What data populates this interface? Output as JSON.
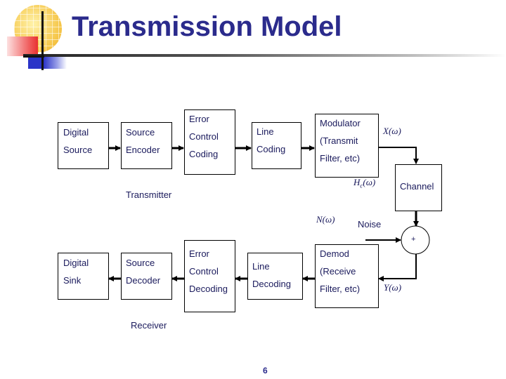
{
  "title": "Transmission Model",
  "transmitter": {
    "label": "Transmitter",
    "blocks": [
      {
        "id": "digital-source",
        "lines": [
          "Digital",
          "Source"
        ]
      },
      {
        "id": "source-encoder",
        "lines": [
          "Source",
          "Encoder"
        ]
      },
      {
        "id": "error-control-coding",
        "lines": [
          "Error",
          "Control",
          "Coding"
        ]
      },
      {
        "id": "line-coding",
        "lines": [
          "Line",
          "Coding"
        ]
      },
      {
        "id": "modulator",
        "lines": [
          "Modulator",
          "(Transmit",
          "Filter, etc)"
        ]
      }
    ]
  },
  "channel": {
    "label": "Channel",
    "noise_label": "Noise",
    "adder_symbol": "+",
    "signals": {
      "x": "X(ω)",
      "hc": "Hc(ω)",
      "hc_main": "H",
      "hc_sub": "c",
      "hc_tail": "(ω)",
      "n": "N(ω)",
      "y": "Y(ω)"
    }
  },
  "receiver": {
    "label": "Receiver",
    "blocks": [
      {
        "id": "digital-sink",
        "lines": [
          "Digital",
          "Sink"
        ]
      },
      {
        "id": "source-decoder",
        "lines": [
          "Source",
          "Decoder"
        ]
      },
      {
        "id": "error-control-decoding",
        "lines": [
          "Error",
          "Control",
          "Decoding"
        ]
      },
      {
        "id": "line-decoding",
        "lines": [
          "Line",
          "Decoding"
        ]
      },
      {
        "id": "demod",
        "lines": [
          "Demod",
          "(Receive",
          "Filter, etc)"
        ]
      }
    ]
  },
  "page_number": "6",
  "colors": {
    "title": "#2b2b8c",
    "text": "#1a1a5c",
    "lines": "#000000"
  }
}
